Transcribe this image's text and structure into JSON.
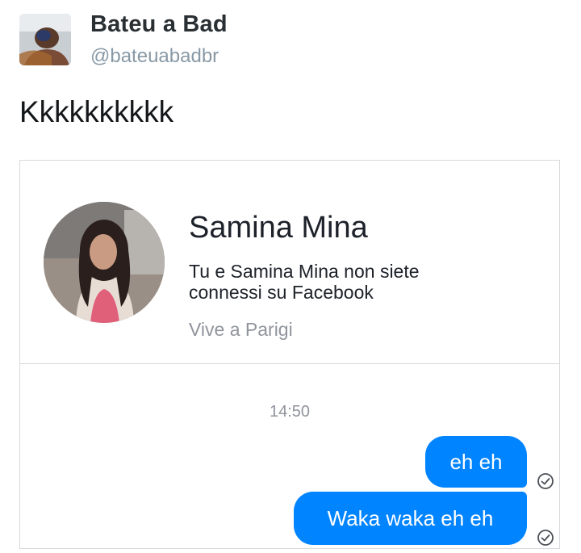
{
  "tweet": {
    "display_name": "Bateu a Bad",
    "handle": "@bateuabadbr",
    "text": "Kkkkkkkkkk"
  },
  "card": {
    "profile": {
      "name": "Samina Mina",
      "connection_text": "Tu e Samina Mina non siete connessi su Facebook",
      "location": "Vive a Parigi"
    },
    "conversation": {
      "timestamp": "14:50",
      "messages": [
        {
          "text": "eh eh",
          "status_icon": "delivered-check-icon"
        },
        {
          "text": "Waka waka eh eh",
          "status_icon": "delivered-check-icon"
        }
      ]
    },
    "colors": {
      "bubble": "#0084ff",
      "bubble_text": "#ffffff"
    }
  }
}
